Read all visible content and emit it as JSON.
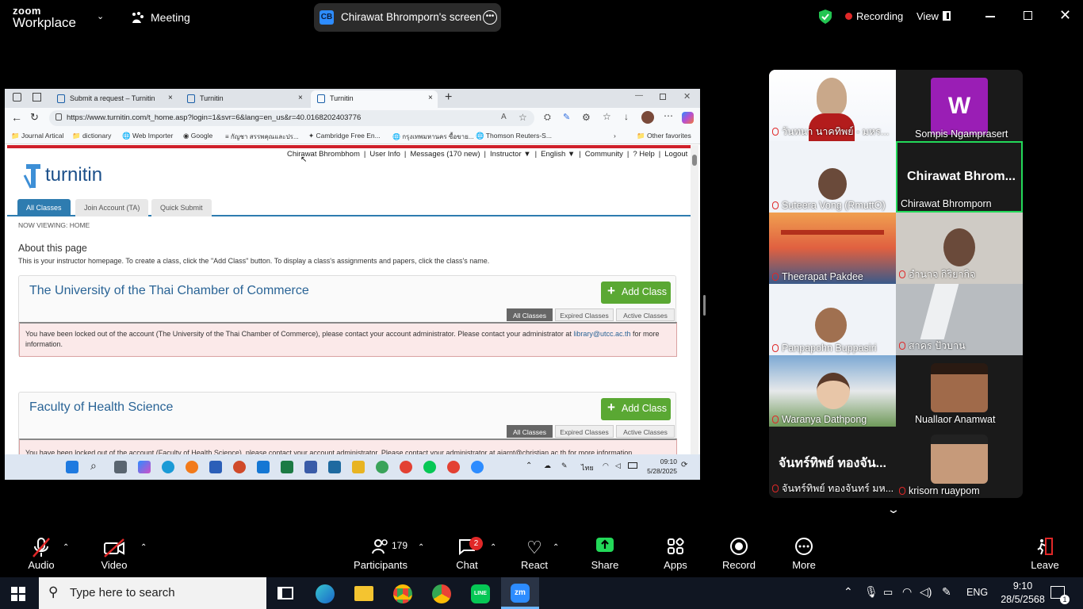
{
  "zoom": {
    "brand_top": "zoom",
    "brand_bottom": "Workplace",
    "meeting_label": "Meeting",
    "screen_badge": "CB",
    "screen_title": "Chirawat Bhromporn's screen",
    "recording": "Recording",
    "view": "View"
  },
  "browser": {
    "tabs": [
      "Submit a request – Turnitin",
      "Turnitin",
      "Turnitin"
    ],
    "url": "https://www.turnitin.com/t_home.asp?login=1&svr=6&lang=en_us&r=40.0168202403776",
    "bookmarks": [
      "Journal Artical",
      "dictionary",
      "Web Importer",
      "Google",
      "กัญชา สรรพคุณและปร...",
      "Cambridge Free En...",
      "กรุงเทพมหานคร ซื้อขาย...",
      "Thomson Reuters-S...",
      "Other favorites"
    ]
  },
  "turnitin": {
    "logo": "turnitin",
    "nav": [
      "Chirawat Bhrombhom",
      "User Info",
      "Messages (170 new)",
      "Instructor ▼",
      "English ▼",
      "Community",
      "? Help",
      "Logout"
    ],
    "tabs": [
      "All Classes",
      "Join Account (TA)",
      "Quick Submit"
    ],
    "now_viewing": "NOW VIEWING: HOME",
    "about_title": "About this page",
    "about_text": "This is your instructor homepage. To create a class, click the \"Add Class\" button. To display a class's assignments and papers, click the class's name.",
    "add_class": "Add Class",
    "filters": [
      "All Classes",
      "Expired Classes",
      "Active Classes"
    ],
    "card1_title": "The University of the Thai Chamber of Commerce",
    "card1_alert_a": "You have been locked out of the account (The University of the Thai Chamber of Commerce), please contact your account administrator. Please contact your administrator at ",
    "card1_email": "library@utcc.ac.th",
    "card1_alert_b": " for more information.",
    "card2_title": "Faculty of Health Science",
    "card2_alert": "You have been locked out of the account (Faculty of Health Science), please contact your account administrator. Please contact your administrator at ajarnt@christian.ac.th for more information."
  },
  "shared_taskbar": {
    "lang": "ไทย",
    "time": "09:10",
    "date": "5/28/2025"
  },
  "participants_gallery": [
    {
      "name": "วันทนา นาคทิพย์ - มหร..."
    },
    {
      "name": "Sompis Ngamprasert",
      "initial": "W"
    },
    {
      "name": "Suteera Vong (RmuttO)"
    },
    {
      "name": "Chirawat Bhromporn",
      "big": "Chirawat  Bhrom..."
    },
    {
      "name": "Theerapat Pakdee"
    },
    {
      "name": "อำนาจ  กิริยากิจ"
    },
    {
      "name": "Panpapohn Buppasiri"
    },
    {
      "name": "สาคร ปัวบาน"
    },
    {
      "name": "Waranya Dathpong"
    },
    {
      "name": "Nuallaor Anamwat"
    },
    {
      "name": "จันทร์ทิพย์ ทองจันทร์ มห...",
      "big": "จันทร์ทิพย์ ทองจัน..."
    },
    {
      "name": "krisorn ruaypom"
    }
  ],
  "toolbar": {
    "audio": "Audio",
    "video": "Video",
    "participants": "Participants",
    "participants_count": "179",
    "chat": "Chat",
    "chat_badge": "2",
    "react": "React",
    "share": "Share",
    "apps": "Apps",
    "record": "Record",
    "more": "More",
    "leave": "Leave"
  },
  "taskbar": {
    "search_placeholder": "Type here to search",
    "lang": "ENG",
    "time": "9:10",
    "date": "28/5/2568",
    "notif": "1"
  },
  "colors": {
    "zoom_blue": "#2d8cff",
    "share_green": "#23d959",
    "turnitin_blue": "#2e7cb0",
    "add_green": "#5aa833",
    "alert_pink": "#fbe9e9"
  }
}
